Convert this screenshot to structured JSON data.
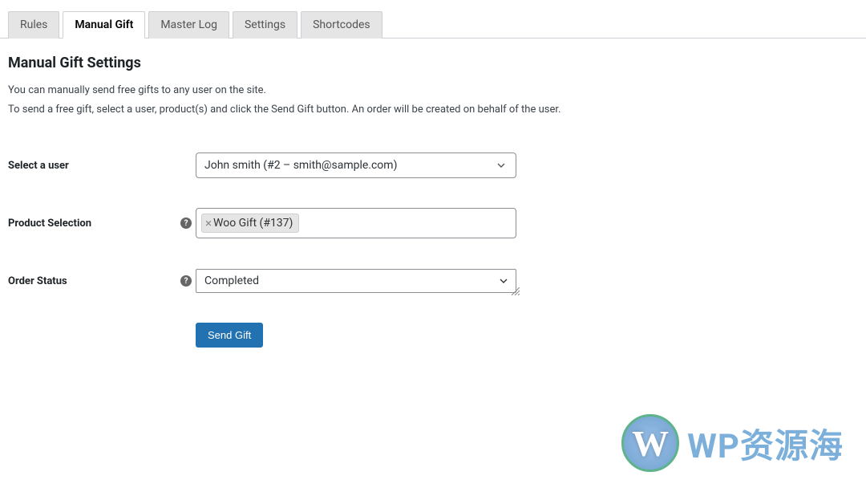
{
  "tabs": {
    "rules": "Rules",
    "manual_gift": "Manual Gift",
    "master_log": "Master Log",
    "settings": "Settings",
    "shortcodes": "Shortcodes"
  },
  "page_title": "Manual Gift Settings",
  "description_line1": "You can manually send free gifts to any user on the site.",
  "description_line2": "To send a free gift, select a user, product(s) and click the Send Gift button. An order will be created on behalf of the user.",
  "fields": {
    "user": {
      "label": "Select a user",
      "selected": "John smith (#2 – smith@sample.com)"
    },
    "product": {
      "label": "Product Selection",
      "tokens": [
        "Woo Gift (#137)"
      ]
    },
    "status": {
      "label": "Order Status",
      "selected": "Completed"
    }
  },
  "submit_label": "Send Gift",
  "watermark": {
    "logo_letter": "W",
    "text": "WP资源海"
  }
}
